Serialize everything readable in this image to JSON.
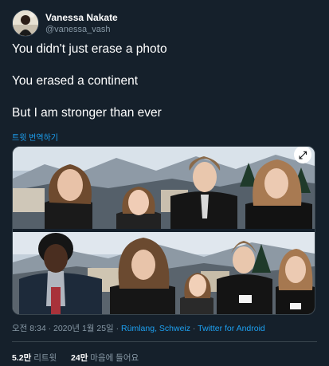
{
  "author": {
    "display_name": "Vanessa Nakate",
    "handle": "@vanessa_vash"
  },
  "tweet": {
    "lines": [
      "You didn't just erase a photo",
      "You erased a continent",
      "But I am stronger than ever"
    ],
    "translate_label": "트윗 번역하기"
  },
  "meta": {
    "time_date": "오전 8:34 · 2020년 1월 25일",
    "location": "Rümlang, Schweiz",
    "source": "Twitter for Android",
    "separator": "·"
  },
  "stats": {
    "retweets_count": "5.2만",
    "retweets_label": "리트윗",
    "likes_count": "24만",
    "likes_label": "마음에 들어요"
  },
  "colors": {
    "background": "#15202b",
    "accent": "#1da1f2",
    "secondary_text": "#8899a6",
    "border": "#38444d"
  }
}
